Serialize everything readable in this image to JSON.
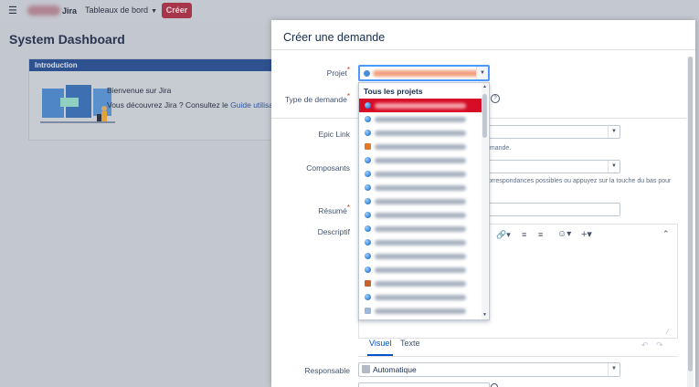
{
  "topbar": {
    "menu_icon": "hamburger-icon",
    "app_name": "Jira",
    "dashboards_label": "Tableaux de bord",
    "create_label": "Créer"
  },
  "dashboard": {
    "title": "System Dashboard",
    "gadget": {
      "title": "Introduction",
      "welcome": "Bienvenue sur Jira",
      "discover": "Vous découvrez Jira ? Consultez le",
      "guide_link": "Guide utilisateur"
    }
  },
  "modal": {
    "title": "Créer une demande",
    "projet_label": "Projet",
    "type_label": "Type de demande",
    "epic_label": "Epic Link",
    "epic_help": "emande.",
    "composants_label": "Composants",
    "composants_help_1": "s correspondances possibles ou appuyez sur la touche du bas pour",
    "resume_label": "Résumé",
    "description_label": "Descriptif",
    "tabs": {
      "visual": "Visuel",
      "text": "Texte"
    },
    "responsable_label": "Responsable",
    "responsable_value": "Automatique",
    "required_mark": "*"
  },
  "dropdown": {
    "heading": "Tous les projets"
  },
  "colors": {
    "accent": "#0052cc",
    "create_button": "#a8364b",
    "gadget_header": "#2e518f",
    "selected_item": "#d60b25"
  }
}
